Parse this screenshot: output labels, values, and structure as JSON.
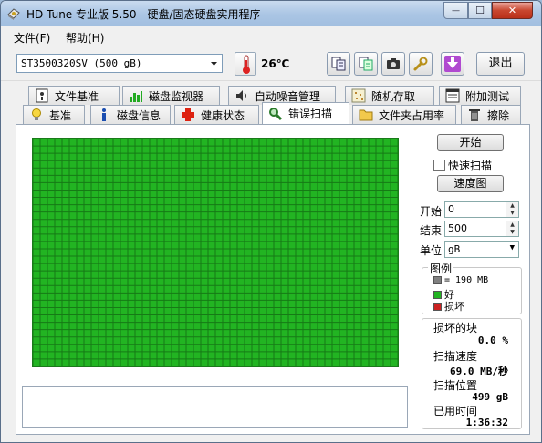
{
  "window": {
    "title": "HD Tune 专业版 5.50 - 硬盘/固态硬盘实用程序",
    "minimize_glyph": "—",
    "maximize_glyph": "☐",
    "close_glyph": "✕"
  },
  "menu": {
    "items": [
      {
        "label": "文件(F)"
      },
      {
        "label": "帮助(H)"
      }
    ]
  },
  "toolbar": {
    "drive": "ST3500320SV (500 gB)",
    "temperature": "26℃",
    "exit_label": "退出",
    "icons": [
      "copy-icon",
      "copy-info-icon",
      "screenshot-camera-icon",
      "options-wrench-icon",
      "download-icon"
    ]
  },
  "tabs": {
    "row1": [
      {
        "label": "文件基准",
        "icon": "file-benchmark-icon"
      },
      {
        "label": "磁盘监视器",
        "icon": "disk-monitor-icon"
      },
      {
        "label": "自动噪音管理",
        "icon": "speaker-icon"
      },
      {
        "label": "随机存取",
        "icon": "random-access-icon"
      },
      {
        "label": "附加测试",
        "icon": "extra-tests-icon"
      }
    ],
    "row2": [
      {
        "label": "基准",
        "icon": "lightbulb-icon"
      },
      {
        "label": "磁盘信息",
        "icon": "info-icon"
      },
      {
        "label": "健康状态",
        "icon": "health-cross-icon"
      },
      {
        "label": "错误扫描",
        "icon": "magnifier-icon",
        "active": true
      },
      {
        "label": "文件夹占用率",
        "icon": "folder-icon"
      },
      {
        "label": "擦除",
        "icon": "trash-icon"
      }
    ]
  },
  "scan": {
    "start_button": "开始",
    "quick_scan_label": "快速扫描",
    "quick_scan_checked": false,
    "speed_map_button": "速度图",
    "start_label": "开始",
    "start_value": "0",
    "end_label": "结束",
    "end_value": "500",
    "unit_label": "单位",
    "unit_value": "gB",
    "block_state": "good"
  },
  "legend": {
    "title": "图例",
    "block_size": "= 190 MB",
    "good": "好",
    "damaged": "损坏",
    "colors": {
      "block": "#808080",
      "good": "#22b422",
      "damaged": "#cc2222"
    }
  },
  "stats": {
    "damaged_blocks_label": "损坏的块",
    "damaged_blocks_value": "0.0 %",
    "scan_speed_label": "扫描速度",
    "scan_speed_value": "69.0 MB/秒",
    "scan_position_label": "扫描位置",
    "scan_position_value": "499 gB",
    "elapsed_label": "已用时间",
    "elapsed_value": "1:36:32"
  }
}
